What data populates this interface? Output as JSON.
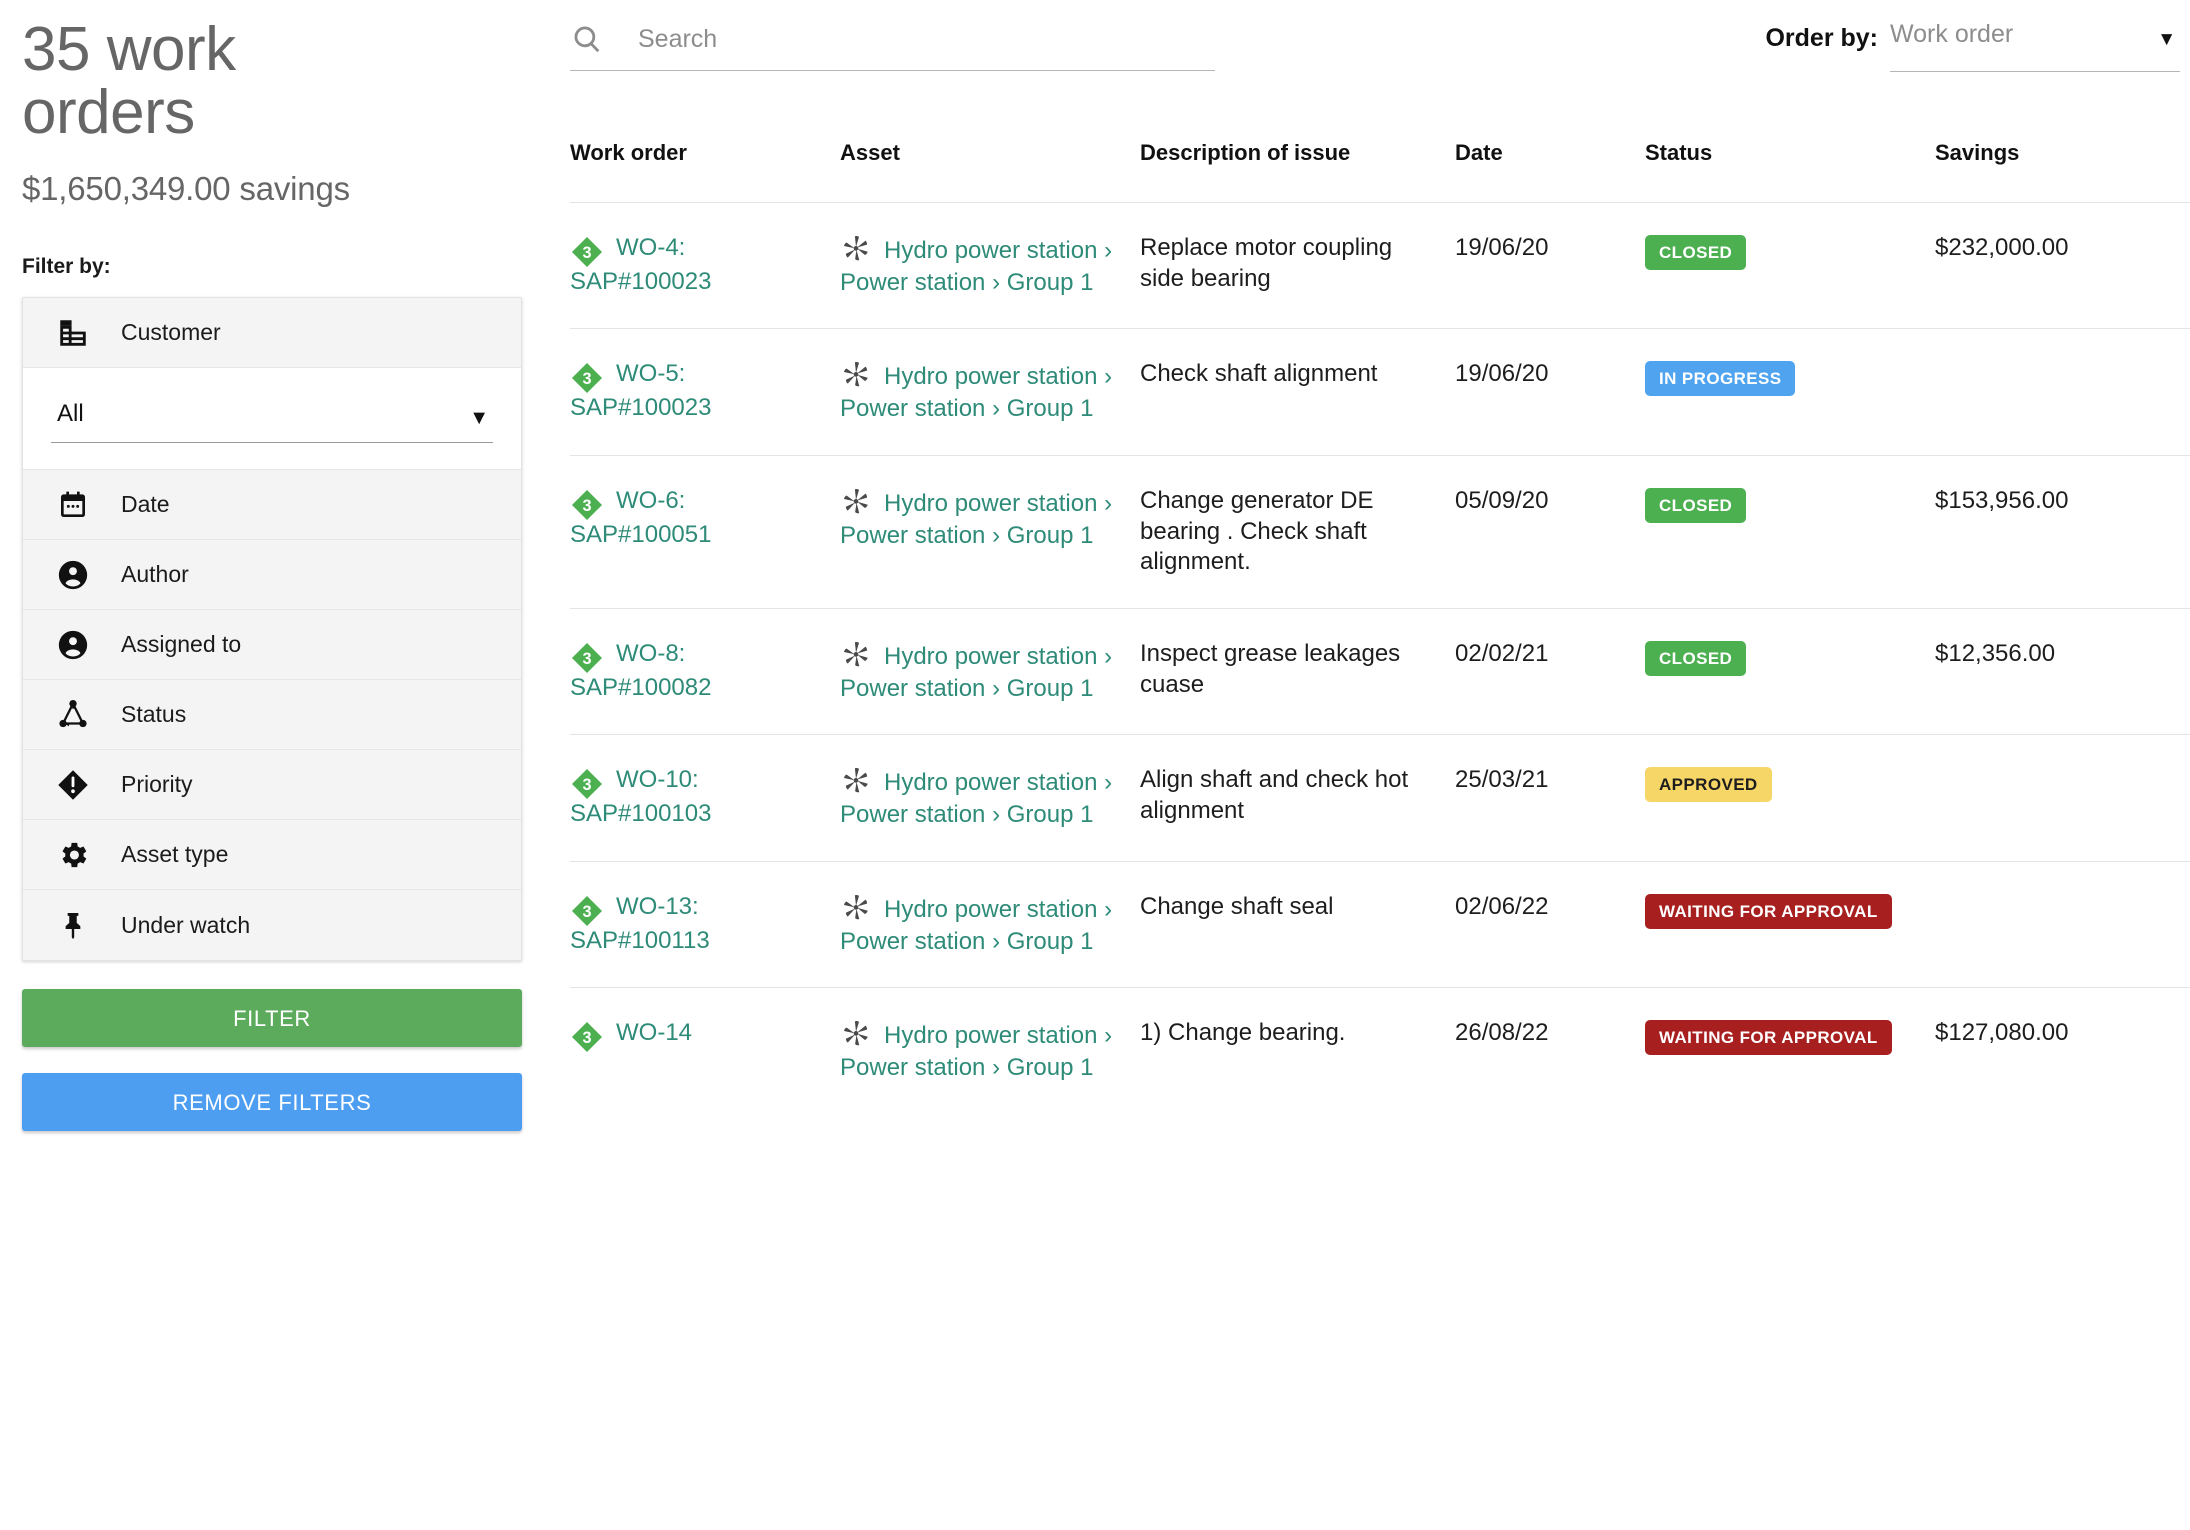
{
  "sidebar": {
    "count_title": "35 work orders",
    "savings_summary": "$1,650,349.00 savings",
    "filter_by_label": "Filter by:",
    "filters": [
      {
        "label": "Customer",
        "icon": "building-icon"
      },
      {
        "label": "Date",
        "icon": "calendar-icon"
      },
      {
        "label": "Author",
        "icon": "person-icon"
      },
      {
        "label": "Assigned to",
        "icon": "person-icon"
      },
      {
        "label": "Status",
        "icon": "workflow-icon"
      },
      {
        "label": "Priority",
        "icon": "priority-diamond-icon"
      },
      {
        "label": "Asset type",
        "icon": "gear-icon"
      },
      {
        "label": "Under watch",
        "icon": "pin-icon"
      }
    ],
    "customer_select": {
      "value": "All",
      "caret": "▼"
    },
    "filter_button": "FILTER",
    "remove_filters_button": "REMOVE FILTERS"
  },
  "toolbar": {
    "search_placeholder": "Search",
    "search_value": "",
    "search_icon": "search-icon",
    "order_by_label": "Order by:",
    "order_by_value": "Work order",
    "order_by_caret": "▼"
  },
  "table": {
    "columns": [
      "Work order",
      "Asset",
      "Description of issue",
      "Date",
      "Status",
      "Savings"
    ],
    "rows": [
      {
        "priority": "3",
        "wo_id": "WO-4:",
        "wo_sap": "SAP#100023",
        "asset_path": [
          "Hydro power station",
          "Power station",
          "Group 1"
        ],
        "description": "Replace motor coupling side bearing",
        "date": "19/06/20",
        "status": "CLOSED",
        "status_kind": "closed",
        "savings": "$232,000.00"
      },
      {
        "priority": "3",
        "wo_id": "WO-5:",
        "wo_sap": "SAP#100023",
        "asset_path": [
          "Hydro power station",
          "Power station",
          "Group 1"
        ],
        "description": "Check shaft alignment",
        "date": "19/06/20",
        "status": "IN PROGRESS",
        "status_kind": "progress",
        "savings": ""
      },
      {
        "priority": "3",
        "wo_id": "WO-6:",
        "wo_sap": "SAP#100051",
        "asset_path": [
          "Hydro power station",
          "Power station",
          "Group 1"
        ],
        "description": "Change generator DE bearing . Check shaft alignment.",
        "date": "05/09/20",
        "status": "CLOSED",
        "status_kind": "closed",
        "savings": "$153,956.00"
      },
      {
        "priority": "3",
        "wo_id": "WO-8:",
        "wo_sap": "SAP#100082",
        "asset_path": [
          "Hydro power station",
          "Power station",
          "Group 1"
        ],
        "description": "Inspect grease leakages cuase",
        "date": "02/02/21",
        "status": "CLOSED",
        "status_kind": "closed",
        "savings": "$12,356.00"
      },
      {
        "priority": "3",
        "wo_id": "WO-10:",
        "wo_sap": "SAP#100103",
        "asset_path": [
          "Hydro power station",
          "Power station",
          "Group 1"
        ],
        "description": "Align shaft and check hot alignment",
        "date": "25/03/21",
        "status": "APPROVED",
        "status_kind": "approved",
        "savings": ""
      },
      {
        "priority": "3",
        "wo_id": "WO-13:",
        "wo_sap": "SAP#100113",
        "asset_path": [
          "Hydro power station",
          "Power station",
          "Group 1"
        ],
        "description": "Change shaft seal",
        "date": "02/06/22",
        "status": "WAITING FOR APPROVAL",
        "status_kind": "waiting",
        "savings": ""
      },
      {
        "priority": "3",
        "wo_id": "WO-14",
        "wo_sap": "",
        "asset_path": [
          "Hydro power station",
          "Power station",
          "Group 1"
        ],
        "description": "1) Change bearing.",
        "date": "26/08/22",
        "status": "WAITING FOR APPROVAL",
        "status_kind": "waiting",
        "savings": "$127,080.00"
      }
    ]
  },
  "colors": {
    "link_teal": "#2e8b78",
    "priority_green": "#4caf50",
    "status_closed": "#4caf50",
    "status_in_progress": "#4fa3ef",
    "status_approved": "#f7d668",
    "status_waiting": "#a81f1f",
    "filter_button": "#5cab5c",
    "remove_filters_button": "#4d9ef0",
    "heading_gray": "#666666"
  }
}
